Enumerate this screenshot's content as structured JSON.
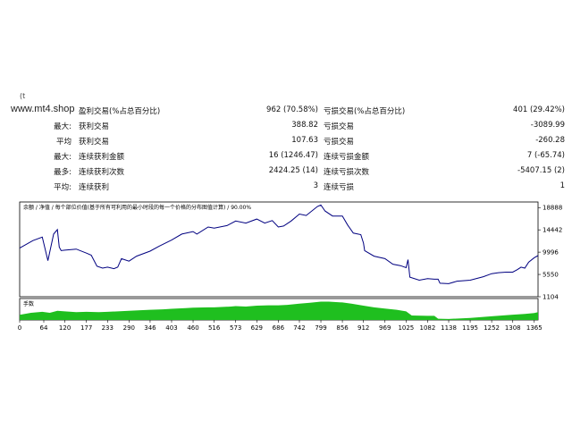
{
  "watermark": "www.mt4.shop",
  "top_mark": "(t",
  "stats": [
    {
      "label1": "",
      "name1": "盈利交易(%占总百分比)",
      "value1": "962 (70.58%)",
      "name2": "亏损交易(%占总百分比)",
      "value2": "401 (29.42%)"
    },
    {
      "label1": "最大:",
      "name1": "获利交易",
      "value1": "388.82",
      "name2": "亏损交易",
      "value2": "-3089.99"
    },
    {
      "label1": "平均",
      "name1": "获利交易",
      "value1": "107.63",
      "name2": "亏损交易",
      "value2": "-260.28"
    },
    {
      "label1": "最大:",
      "name1": "连续获利金额",
      "value1": "16 (1246.47)",
      "name2": "连续亏损金额",
      "value2": "7 (-65.74)"
    },
    {
      "label1": "最多:",
      "name1": "连续获利次数",
      "value1": "2424.25 (14)",
      "name2": "连续亏损次数",
      "value2": "-5407.15 (2)"
    },
    {
      "label1": "平均:",
      "name1": "连续获利",
      "value1": "3",
      "name2": "连续亏损",
      "value2": "1"
    }
  ],
  "chart_data": {
    "type": "line",
    "header": "余额 / 净值 / 每个部位价值(基于所有可利用的最小时段的每一个价格的分布图值计算) / 90.00%",
    "lot_panel_label": "手数",
    "y_ticks": [
      18888,
      14442,
      9996,
      5550,
      1104
    ],
    "x_ticks": [
      0,
      64,
      120,
      177,
      233,
      290,
      346,
      403,
      460,
      516,
      573,
      629,
      686,
      742,
      799,
      856,
      912,
      969,
      1025,
      1082,
      1138,
      1195,
      1252,
      1308,
      1365
    ],
    "xlim": [
      0,
      1375
    ],
    "ylim": [
      1104,
      20000
    ],
    "series": [
      {
        "values": [
          [
            0,
            10800
          ],
          [
            35,
            12300
          ],
          [
            60,
            13000
          ],
          [
            75,
            8300
          ],
          [
            90,
            13600
          ],
          [
            100,
            14500
          ],
          [
            105,
            11000
          ],
          [
            110,
            10300
          ],
          [
            120,
            10400
          ],
          [
            150,
            10600
          ],
          [
            177,
            9800
          ],
          [
            190,
            9400
          ],
          [
            205,
            7200
          ],
          [
            220,
            6800
          ],
          [
            233,
            7000
          ],
          [
            250,
            6700
          ],
          [
            260,
            7000
          ],
          [
            270,
            8700
          ],
          [
            290,
            8200
          ],
          [
            310,
            9200
          ],
          [
            346,
            10200
          ],
          [
            370,
            11200
          ],
          [
            403,
            12400
          ],
          [
            430,
            13600
          ],
          [
            460,
            14100
          ],
          [
            470,
            13600
          ],
          [
            500,
            15000
          ],
          [
            516,
            14800
          ],
          [
            550,
            15300
          ],
          [
            573,
            16200
          ],
          [
            600,
            15800
          ],
          [
            629,
            16600
          ],
          [
            650,
            15800
          ],
          [
            670,
            16300
          ],
          [
            686,
            15000
          ],
          [
            700,
            15200
          ],
          [
            720,
            16200
          ],
          [
            742,
            17600
          ],
          [
            760,
            17300
          ],
          [
            790,
            19100
          ],
          [
            799,
            19400
          ],
          [
            810,
            18200
          ],
          [
            830,
            17200
          ],
          [
            856,
            17200
          ],
          [
            870,
            15400
          ],
          [
            885,
            13800
          ],
          [
            905,
            13500
          ],
          [
            912,
            11800
          ],
          [
            915,
            10300
          ],
          [
            940,
            9200
          ],
          [
            969,
            8700
          ],
          [
            990,
            7600
          ],
          [
            1010,
            7300
          ],
          [
            1025,
            6900
          ],
          [
            1030,
            8500
          ],
          [
            1035,
            5000
          ],
          [
            1060,
            4400
          ],
          [
            1082,
            4700
          ],
          [
            1100,
            4600
          ],
          [
            1110,
            4600
          ],
          [
            1115,
            3800
          ],
          [
            1138,
            3700
          ],
          [
            1160,
            4200
          ],
          [
            1195,
            4400
          ],
          [
            1230,
            5100
          ],
          [
            1252,
            5700
          ],
          [
            1270,
            5900
          ],
          [
            1290,
            6000
          ],
          [
            1308,
            6000
          ],
          [
            1320,
            6500
          ],
          [
            1330,
            7000
          ],
          [
            1340,
            6800
          ],
          [
            1350,
            8000
          ],
          [
            1365,
            8900
          ],
          [
            1375,
            9300
          ]
        ],
        "color": "#000080"
      }
    ],
    "lots": [
      [
        0,
        0.25
      ],
      [
        30,
        0.35
      ],
      [
        60,
        0.4
      ],
      [
        80,
        0.35
      ],
      [
        100,
        0.45
      ],
      [
        120,
        0.42
      ],
      [
        150,
        0.38
      ],
      [
        177,
        0.4
      ],
      [
        210,
        0.38
      ],
      [
        233,
        0.4
      ],
      [
        260,
        0.42
      ],
      [
        290,
        0.45
      ],
      [
        320,
        0.48
      ],
      [
        346,
        0.5
      ],
      [
        380,
        0.52
      ],
      [
        403,
        0.55
      ],
      [
        440,
        0.58
      ],
      [
        460,
        0.6
      ],
      [
        500,
        0.62
      ],
      [
        516,
        0.62
      ],
      [
        560,
        0.66
      ],
      [
        573,
        0.68
      ],
      [
        600,
        0.66
      ],
      [
        629,
        0.7
      ],
      [
        660,
        0.72
      ],
      [
        686,
        0.72
      ],
      [
        710,
        0.74
      ],
      [
        742,
        0.8
      ],
      [
        770,
        0.84
      ],
      [
        799,
        0.9
      ],
      [
        820,
        0.9
      ],
      [
        856,
        0.86
      ],
      [
        880,
        0.8
      ],
      [
        912,
        0.7
      ],
      [
        940,
        0.62
      ],
      [
        969,
        0.56
      ],
      [
        1000,
        0.5
      ],
      [
        1025,
        0.42
      ],
      [
        1040,
        0.22
      ],
      [
        1082,
        0.2
      ],
      [
        1100,
        0.2
      ],
      [
        1110,
        0.06
      ],
      [
        1138,
        0.05
      ],
      [
        1195,
        0.1
      ],
      [
        1252,
        0.18
      ],
      [
        1280,
        0.22
      ],
      [
        1308,
        0.26
      ],
      [
        1340,
        0.3
      ],
      [
        1365,
        0.34
      ],
      [
        1375,
        0.38
      ]
    ],
    "line_color": "#000080",
    "lot_color": "#1fbf1f",
    "grid": false
  }
}
